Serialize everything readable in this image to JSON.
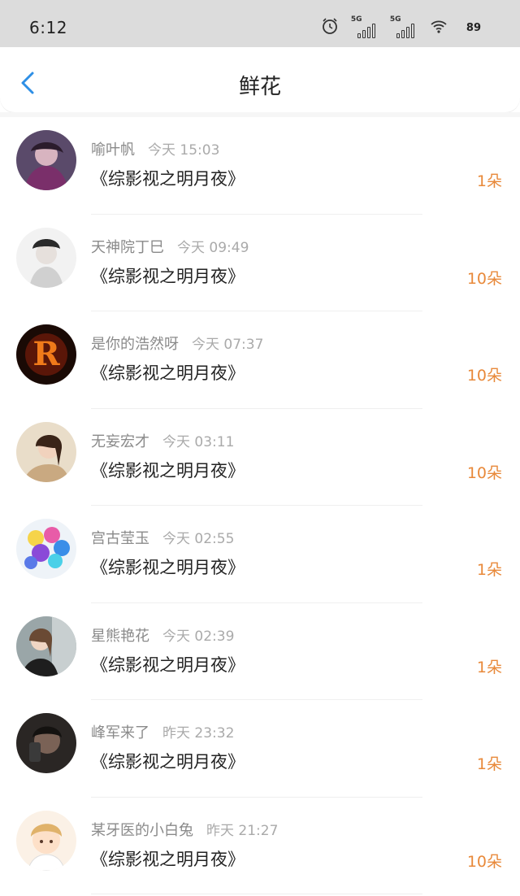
{
  "status_bar": {
    "time": "6:12",
    "signal_label_1": "5G",
    "signal_label_2": "5G",
    "battery": "89",
    "icons": [
      "alarm-icon",
      "signal-5g-icon",
      "signal-5g-icon",
      "wifi-icon",
      "battery-icon"
    ]
  },
  "nav": {
    "title": "鲜花",
    "back_icon": "chevron-left-icon",
    "accent_color": "#2e8fe6"
  },
  "colors": {
    "amount": "#e8893a",
    "name": "#8a8a8a",
    "time": "#aaaaaa"
  },
  "items": [
    {
      "name": "喻叶帆",
      "time": "今天 15:03",
      "work": "《综影视之明月夜》",
      "amount": "1朵"
    },
    {
      "name": "天神院丁巳",
      "time": "今天 09:49",
      "work": "《综影视之明月夜》",
      "amount": "10朵"
    },
    {
      "name": "是你的浩然呀",
      "time": "今天 07:37",
      "work": "《综影视之明月夜》",
      "amount": "10朵"
    },
    {
      "name": "无妄宏才",
      "time": "今天 03:11",
      "work": "《综影视之明月夜》",
      "amount": "10朵"
    },
    {
      "name": "宫古莹玉",
      "time": "今天 02:55",
      "work": "《综影视之明月夜》",
      "amount": "1朵"
    },
    {
      "name": "星熊艳花",
      "time": "今天 02:39",
      "work": "《综影视之明月夜》",
      "amount": "1朵"
    },
    {
      "name": "峰军来了",
      "time": "昨天 23:32",
      "work": "《综影视之明月夜》",
      "amount": "1朵"
    },
    {
      "name": "某牙医的小白兔",
      "time": "昨天 21:27",
      "work": "《综影视之明月夜》",
      "amount": "10朵"
    }
  ]
}
